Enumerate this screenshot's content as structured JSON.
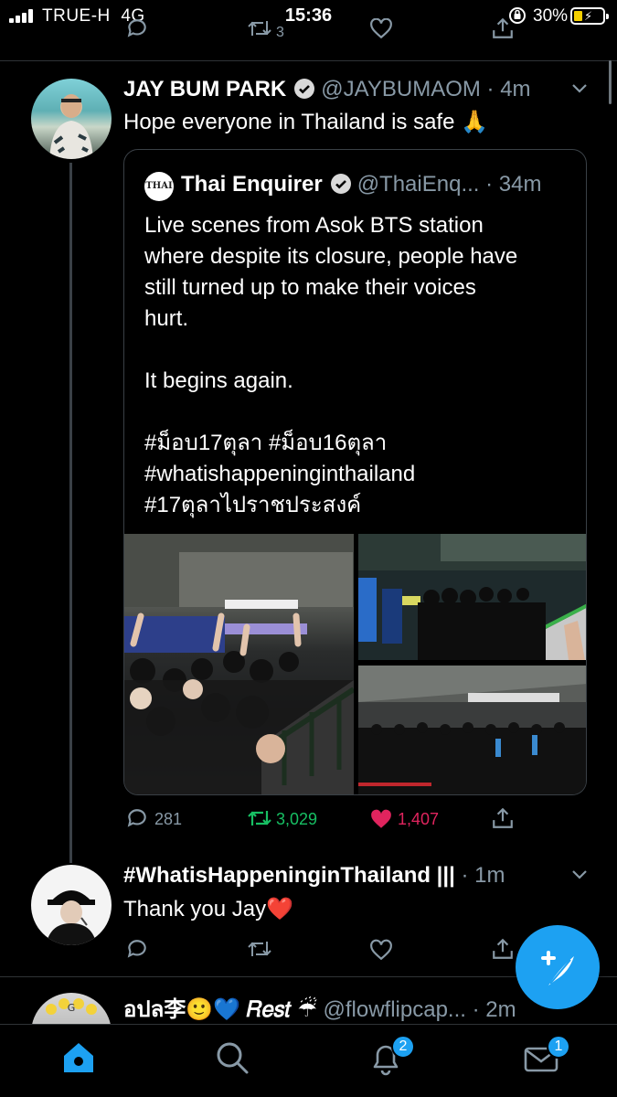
{
  "status_bar": {
    "carrier": "TRUE-H",
    "network": "4G",
    "time": "15:36",
    "battery_percent": "30%",
    "battery_level": 0.3,
    "battery_color": "#f5d000"
  },
  "top_action_row": {
    "retweet_count": "3"
  },
  "main_tweet": {
    "display_name": "JAY BUM PARK",
    "handle": "@JAYBUMAOM",
    "time": "4m",
    "text": "Hope everyone in Thailand is safe 🙏",
    "quoted": {
      "logo_text": "THAI",
      "display_name": "Thai Enquirer",
      "handle": "@ThaiEnq...",
      "time": "34m",
      "lines": [
        "Live scenes from Asok BTS station",
        "where despite its closure, people have",
        "still turned up to make their voices",
        "hurt.",
        "",
        "It begins again.",
        "",
        "#ม็อบ17ตุลา #ม็อบ16ตุลา",
        "#whatishappeninginthailand",
        "#17ตุลาไปราชประสงค์"
      ]
    },
    "stats": {
      "replies": "281",
      "retweets": "3,029",
      "likes": "1,407"
    }
  },
  "reply_tweet": {
    "display_name": "#WhatisHappeninginThailand |||",
    "time": "1m",
    "text": "Thank you Jay❤️"
  },
  "third_tweet": {
    "display_name": "อปล李🙂💙 𝑅𝑒𝑠𝑡 ☔",
    "handle": "@flowflipcap...",
    "time": "2m"
  },
  "nav": {
    "notifications_badge": "2",
    "messages_badge": "1"
  },
  "colors": {
    "accent": "#1da1f2",
    "retweet": "#17bf63",
    "like": "#e0245e",
    "muted": "#8899a6"
  }
}
